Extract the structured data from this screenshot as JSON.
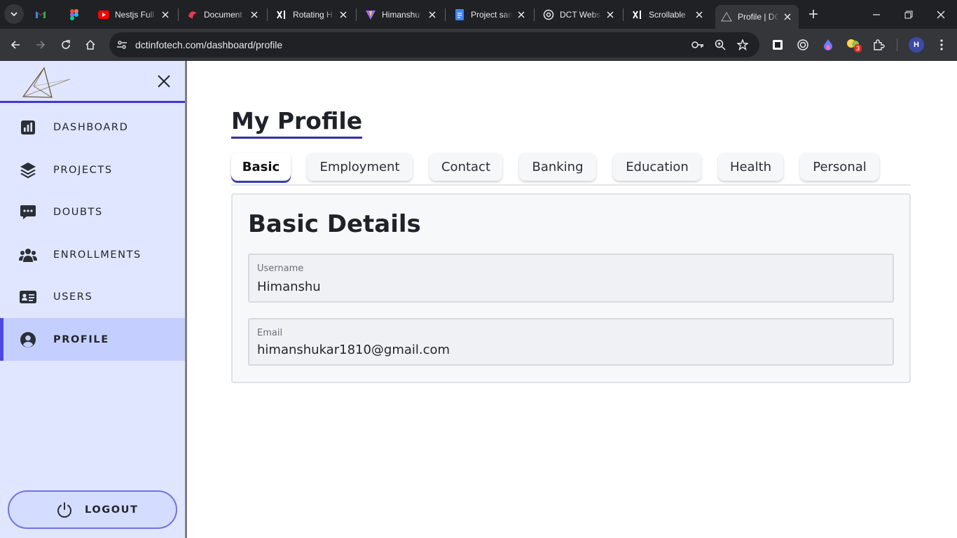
{
  "browser": {
    "tabs": [
      {
        "title": "",
        "icon": "gmail-icon"
      },
      {
        "title": "",
        "icon": "figma-icon"
      },
      {
        "title": "Nestjs Full",
        "icon": "youtube-icon"
      },
      {
        "title": "Document",
        "icon": "document-icon"
      },
      {
        "title": "Rotating H",
        "icon": "xl-icon"
      },
      {
        "title": "Himanshu",
        "icon": "vite-icon"
      },
      {
        "title": "Project san",
        "icon": "google-docs-icon"
      },
      {
        "title": "DCT Webs",
        "icon": "openai-icon"
      },
      {
        "title": "Scrollable",
        "icon": "xl-icon"
      },
      {
        "title": "Profile | DC",
        "icon": "dct-logo-icon"
      }
    ],
    "url": "dctinfotech.com/dashboard/profile",
    "extension_badge": "3",
    "profile_initial": "H"
  },
  "sidebar": {
    "items": [
      {
        "label": "DASHBOARD",
        "icon": "bar-chart-icon"
      },
      {
        "label": "PROJECTS",
        "icon": "layers-icon"
      },
      {
        "label": "DOUBTS",
        "icon": "chat-bubble-icon"
      },
      {
        "label": "ENROLLMENTS",
        "icon": "users-group-icon"
      },
      {
        "label": "USERS",
        "icon": "id-card-icon"
      },
      {
        "label": "PROFILE",
        "icon": "user-circle-icon",
        "active": true
      }
    ],
    "logout_label": "LOGOUT"
  },
  "main": {
    "title": "My Profile",
    "tabs": [
      "Basic",
      "Employment",
      "Contact",
      "Banking",
      "Education",
      "Health",
      "Personal"
    ],
    "active_tab": "Basic",
    "card_title": "Basic Details",
    "fields": [
      {
        "label": "Username",
        "value": "Himanshu"
      },
      {
        "label": "Email",
        "value": "himanshukar1810@gmail.com"
      }
    ]
  },
  "colors": {
    "sidebar_bg": "#e0e6ff",
    "sidebar_active_bg": "#c4cfff",
    "accent": "#4338ca"
  }
}
